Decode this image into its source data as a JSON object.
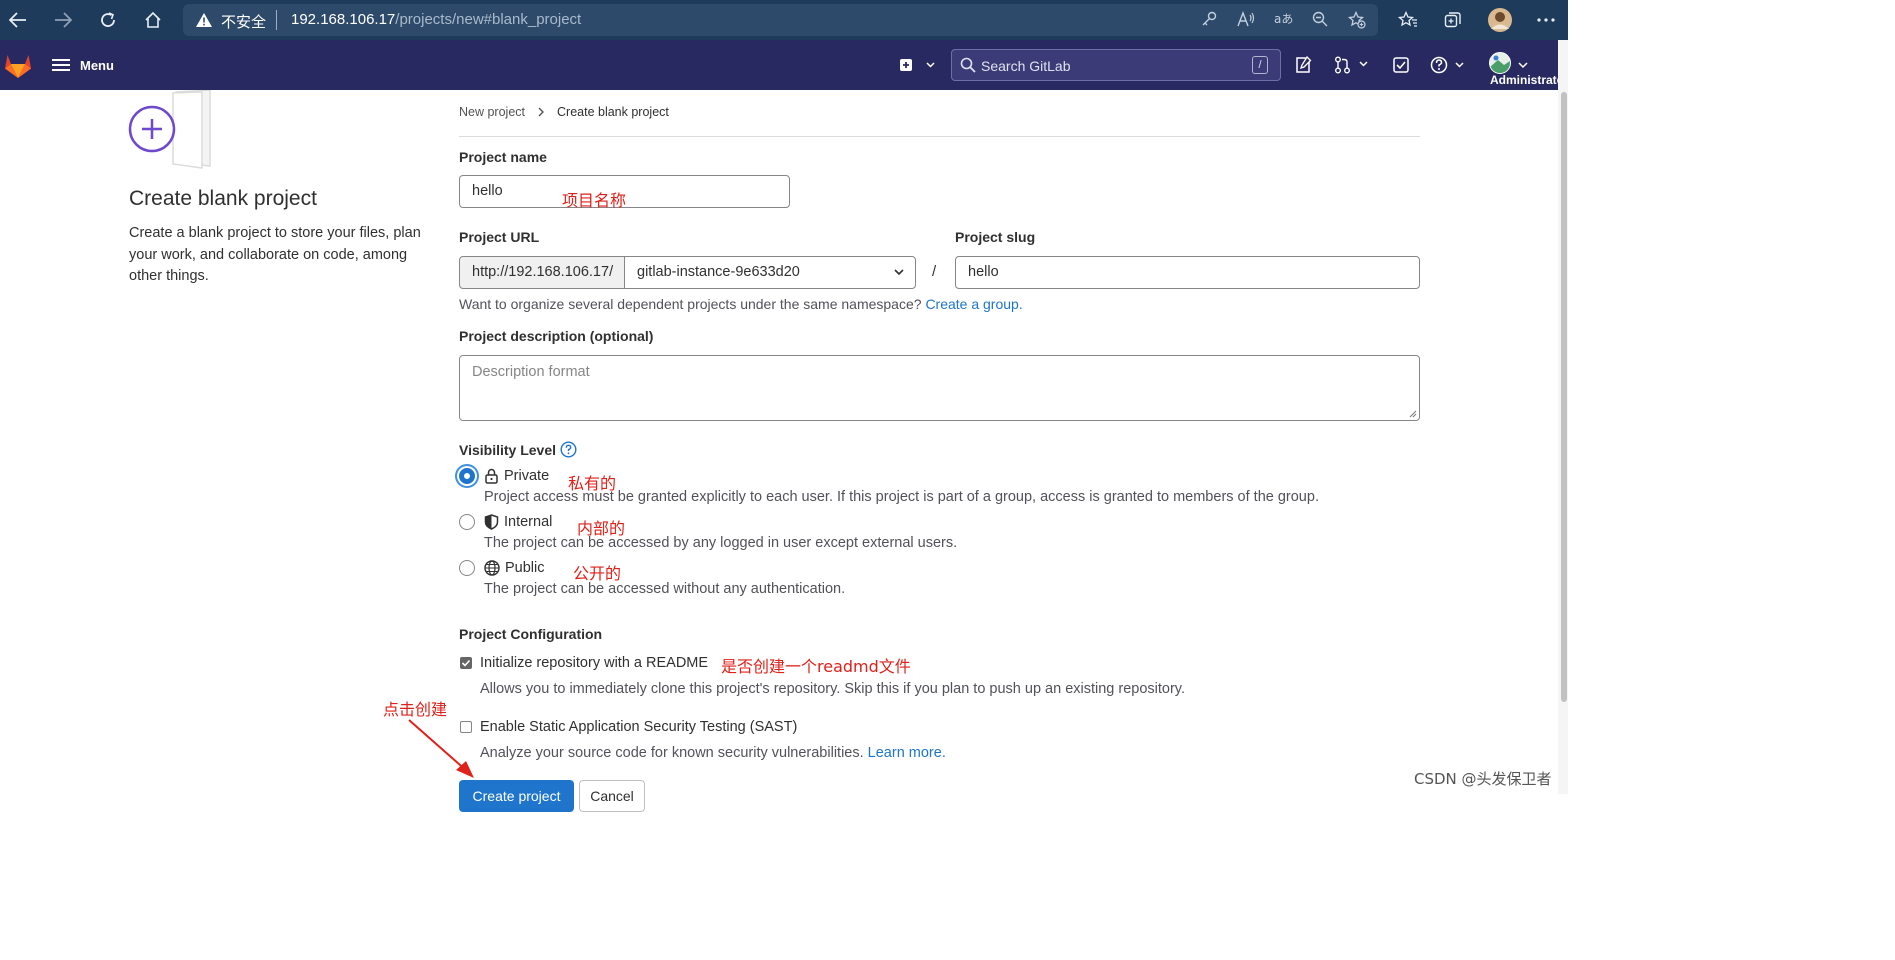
{
  "browser": {
    "insecure_label": "不安全",
    "url_host": "192.168.106.17",
    "url_path": "/projects/new#blank_project"
  },
  "header": {
    "menu_label": "Menu",
    "search_placeholder": "Search GitLab",
    "search_shortcut": "/",
    "user_label": "Administrato"
  },
  "sidebar": {
    "title": "Create blank project",
    "description": "Create a blank project to store your files, plan your work, and collaborate on code, among other things."
  },
  "breadcrumb": {
    "parent": "New project",
    "current": "Create blank project"
  },
  "form": {
    "project_name_label": "Project name",
    "project_name_value": "hello",
    "project_url_label": "Project URL",
    "url_prefix": "http://192.168.106.17/",
    "namespace_value": "gitlab-instance-9e633d20",
    "url_separator": "/",
    "project_slug_label": "Project slug",
    "project_slug_value": "hello",
    "namespace_help": "Want to organize several dependent projects under the same namespace?",
    "namespace_help_link": "Create a group.",
    "description_label": "Project description (optional)",
    "description_placeholder": "Description format",
    "visibility_label": "Visibility Level",
    "visibility_options": [
      {
        "name": "Private",
        "selected": true,
        "description": "Project access must be granted explicitly to each user. If this project is part of a group, access is granted to members of the group."
      },
      {
        "name": "Internal",
        "selected": false,
        "description": "The project can be accessed by any logged in user except external users."
      },
      {
        "name": "Public",
        "selected": false,
        "description": "The project can be accessed without any authentication."
      }
    ],
    "config_label": "Project Configuration",
    "readme_label": "Initialize repository with a README",
    "readme_checked": true,
    "readme_help": "Allows you to immediately clone this project's repository. Skip this if you plan to push up an existing repository.",
    "sast_label": "Enable Static Application Security Testing (SAST)",
    "sast_checked": false,
    "sast_help": "Analyze your source code for known security vulnerabilities.",
    "sast_help_link": "Learn more.",
    "create_button": "Create project",
    "cancel_button": "Cancel"
  },
  "annotations": {
    "name": "项目名称",
    "private": "私有的",
    "internal": "内部的",
    "public": "公开的",
    "readme": "是否创建一个readmd文件",
    "click_create": "点击创建"
  },
  "watermark": "CSDN @头发保卫者",
  "colors": {
    "header_bg": "#292961",
    "browser_bg": "#1f3b5c",
    "primary": "#1f75cb",
    "annotation": "#e0201a"
  }
}
